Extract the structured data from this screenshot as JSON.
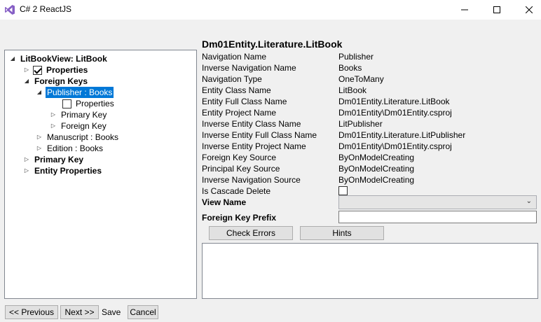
{
  "window": {
    "title": "C# 2 ReactJS",
    "logo_icon": "visual-studio-icon",
    "accent": "#0078d7"
  },
  "tree": {
    "root": "LitBookView: LitBook",
    "properties": "Properties",
    "foreign_keys": "Foreign Keys",
    "publisher_books": "Publisher : Books",
    "fk_properties": "Properties",
    "fk_primary_key": "Primary Key",
    "fk_foreign_key": "Foreign Key",
    "manuscript_books": "Manuscript : Books",
    "edition_books": "Edition : Books",
    "primary_key": "Primary Key",
    "entity_properties": "Entity Properties"
  },
  "details": {
    "header": "Dm01Entity.Literature.LitBook",
    "rows": [
      {
        "label": "Navigation Name",
        "value": "Publisher"
      },
      {
        "label": "Inverse Navigation Name",
        "value": "Books"
      },
      {
        "label": "Navigation Type",
        "value": "OneToMany"
      },
      {
        "label": "Entity Class Name",
        "value": "LitBook"
      },
      {
        "label": "Entity Full Class Name",
        "value": "Dm01Entity.Literature.LitBook"
      },
      {
        "label": "Entity Project Name",
        "value": "Dm01Entity\\Dm01Entity.csproj"
      },
      {
        "label": "Inverse Entity Class Name",
        "value": "LitPublisher"
      },
      {
        "label": "Inverse Entity Full Class Name",
        "value": "Dm01Entity.Literature.LitPublisher"
      },
      {
        "label": "Inverse Entity Project Name",
        "value": "Dm01Entity\\Dm01Entity.csproj"
      },
      {
        "label": "Foreign Key Source",
        "value": "ByOnModelCreating"
      },
      {
        "label": "Principal Key Source",
        "value": "ByOnModelCreating"
      },
      {
        "label": "Inverse Navigation Source",
        "value": "ByOnModelCreating"
      }
    ],
    "cascade_label": "Is Cascade Delete",
    "view_name_label": "View Name",
    "view_name_value": "",
    "fk_prefix_label": "Foreign Key Prefix",
    "fk_prefix_value": ""
  },
  "buttons": {
    "check_errors": "Check Errors",
    "hints": "Hints"
  },
  "footer": {
    "previous": "<< Previous",
    "next": "Next >>",
    "save": "Save",
    "cancel": "Cancel"
  }
}
